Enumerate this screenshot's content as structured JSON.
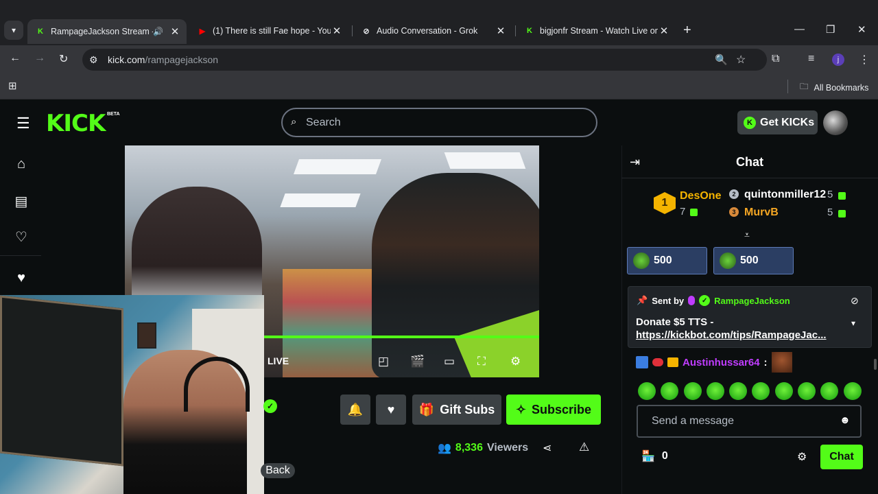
{
  "browser": {
    "tabs": [
      {
        "title": "RampageJackson Stream - W",
        "favicon": "kick-icon",
        "audio": true
      },
      {
        "title": "(1) There is still Fae hope - YouT",
        "favicon": "youtube-icon"
      },
      {
        "title": "Audio Conversation - Grok",
        "favicon": "grok-icon"
      },
      {
        "title": "bigjonfr Stream - Watch Live on",
        "favicon": "kick-icon"
      }
    ],
    "url_host": "kick.com",
    "url_path": "/rampagejackson",
    "profile_initial": "j",
    "bookmarks_label": "All Bookmarks"
  },
  "site": {
    "logo": "KICK",
    "beta": "BETA",
    "search_placeholder": "Search",
    "get_kicks": "Get KICKs"
  },
  "player": {
    "live_label": "LIVE",
    "progress_fraction": 1.0
  },
  "channel": {
    "gift_subs": "Gift Subs",
    "subscribe": "Subscribe",
    "viewers_count": "8,336",
    "viewers_label": "Viewers",
    "back_label": "Back"
  },
  "chat": {
    "title": "Chat",
    "leaderboard": [
      {
        "rank": "1",
        "name": "DesOne",
        "count": "7",
        "color": "#f5b400"
      },
      {
        "rank": "2",
        "name": "quintonmiller12",
        "count": "5",
        "color": "#ffffff"
      },
      {
        "rank": "3",
        "name": "MurvB",
        "count": "5",
        "color": "#f5a623"
      }
    ],
    "goals": [
      {
        "value": "500"
      },
      {
        "value": "500"
      }
    ],
    "pinned": {
      "sent_by": "Sent by",
      "user": "RampageJackson",
      "message": "Donate $5 TTS -",
      "link": "https://kickbot.com/tips/RampageJac..."
    },
    "message": {
      "user": "Austinhussar64",
      "separator": ":"
    },
    "input_placeholder": "Send a message",
    "store_count": "0",
    "send_label": "Chat"
  },
  "colors": {
    "kick_green": "#53fc18",
    "background": "#0b0e0f",
    "chrome_bg": "#202124"
  }
}
